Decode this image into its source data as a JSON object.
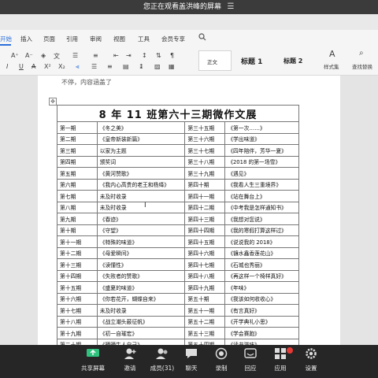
{
  "topbar": {
    "share_notice": "您正在观看盖洪峰的屏幕",
    "menu_glyph": "☰"
  },
  "ribbon": {
    "tabs": [
      "开始",
      "插入",
      "页面",
      "引用",
      "审阅",
      "视图",
      "工具",
      "会员专享"
    ],
    "search_icon": "search-icon"
  },
  "toolbar": {
    "style_normal": "正文",
    "style_h1": "标题 1",
    "style_h2": "标题 2",
    "style_set_label": "样式集",
    "find_replace_label": "查找替换"
  },
  "document": {
    "overflow_text": "不停，内容涵盖了",
    "table_title": "8 年 11 班第六十三期微作文展",
    "rows": [
      [
        "第一期",
        "《冬之美》",
        "第三十五期",
        "《第一次……》"
      ],
      [
        "第二期",
        "《皇帝新装新篇》",
        "第三十六期",
        "《学出味道》"
      ],
      [
        "第三期",
        "以家为主题",
        "第三十七期",
        "《四年陪伴，芳华一夏》"
      ],
      [
        "第四期",
        "颁奖词",
        "第三十八期",
        "《2018 的第一场雪》"
      ],
      [
        "第五期",
        "《黄河赞歌》",
        "第三十九期",
        "《遇见》"
      ],
      [
        "第六期",
        "《我内心高贵的老王和杨绛》",
        "第四十期",
        "《我看人生三重境界》"
      ],
      [
        "第七期",
        "未及时收录",
        "第四十一期",
        "《站在舞台上》"
      ],
      [
        "第八期",
        "未及时收录",
        "第四十二期",
        "《中考我是怎样通知书》"
      ],
      [
        "第九期",
        "《春迹》",
        "第四十三期",
        "《我想对您说》"
      ],
      [
        "第十期",
        "《守望》",
        "第四十四期",
        "《我的寒假打算这样过》"
      ],
      [
        "第十一期",
        "《特殊的味道》",
        "第四十五期",
        "《说说我的 2018》"
      ],
      [
        "第十二期",
        "《母爱瞬间》",
        "第四十六期",
        "《镰水鑫香莲花山》"
      ],
      [
        "第十三期",
        "《读懂性》",
        "第四十七期",
        "《石城也秀丽》"
      ],
      [
        "第十四期",
        "《失败者的赞歌》",
        "第四十八期",
        "《再这样一个椅样真好》"
      ],
      [
        "第十五期",
        "《盛夏的味道》",
        "第四十九期",
        "《年味》"
      ],
      [
        "第十六期",
        "《你若花开，蝴蝶自来》",
        "第五十期",
        "《我该如何收收心》"
      ],
      [
        "第十七期",
        "未及时收录",
        "第五十一期",
        "《有言真好》"
      ],
      [
        "第十八期",
        "《战立潮头蔽征帆》",
        "第五十二期",
        "《开学典礼小思》"
      ],
      [
        "第十九期",
        "《初一自璀宏》",
        "第五十三期",
        "《学会赛跑》"
      ],
      [
        "第二十期",
        "《晒晒牛人自己》",
        "第五十四期",
        "《读书滋味》"
      ]
    ]
  },
  "bottombar": {
    "items": [
      {
        "label": "共享屏幕",
        "icon": "share-screen-icon"
      },
      {
        "label": "邀请",
        "icon": "invite-icon"
      },
      {
        "label": "成员(31)",
        "icon": "members-icon"
      },
      {
        "label": "聊天",
        "icon": "chat-icon"
      },
      {
        "label": "录制",
        "icon": "record-icon"
      },
      {
        "label": "回应",
        "icon": "reaction-icon"
      },
      {
        "label": "应用",
        "icon": "apps-icon"
      },
      {
        "label": "设置",
        "icon": "settings-icon"
      }
    ]
  },
  "colors": {
    "accent": "#2a6fdb",
    "bar_dark": "#262626",
    "top_dark": "#3b3b3b",
    "badge": "#e53935"
  }
}
